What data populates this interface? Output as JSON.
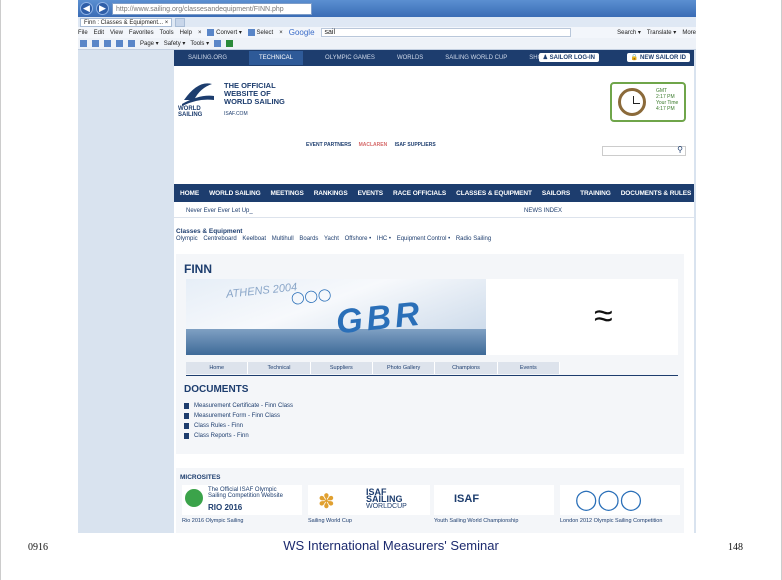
{
  "browser": {
    "back_icon": "back-arrow-icon",
    "forward_icon": "forward-arrow-icon",
    "url": "http://www.sailing.org/classesandequipment/FINN.php",
    "url_host": "sailing.org",
    "tab_title": "Finn : Classes & Equipment...",
    "menu": [
      "File",
      "Edit",
      "View",
      "Favorites",
      "Tools",
      "Help"
    ],
    "convert_label": "Convert",
    "select_label": "Select",
    "google_label": "Google",
    "google_query": "sail",
    "search_label": "Search",
    "translate_label": "Translate",
    "more_label": "More",
    "cmd_page": "Page",
    "cmd_safety": "Safety",
    "cmd_tools": "Tools"
  },
  "site": {
    "topnav": [
      "SAILING.ORG",
      "TECHNICAL",
      "OLYMPIC GAMES",
      "WORLDS",
      "SAILING WORLD CUP",
      "SHOP"
    ],
    "login_label": "SAILOR LOG-IN",
    "newid_label": "NEW SAILOR ID",
    "logo_lines": [
      "THE OFFICIAL",
      "WEBSITE OF",
      "WORLD SAILING"
    ],
    "logo_word1": "WORLD",
    "logo_word2": "SAILING",
    "isaf_com": "ISAF.COM",
    "clock": {
      "gmt": "GMT",
      "gmt_time": "2:17 PM",
      "your_time": "Your Time",
      "local_time": "4:17 PM"
    },
    "event_partners": "EVENT PARTNERS",
    "maclaren": "MACLAREN",
    "isaf_suppliers": "ISAF SUPPLIERS",
    "mainnav": [
      "HOME",
      "WORLD SAILING",
      "MEETINGS",
      "RANKINGS",
      "EVENTS",
      "RACE OFFICIALS",
      "CLASSES & EQUIPMENT",
      "SAILORS",
      "TRAINING",
      "DOCUMENTS & RULES"
    ],
    "ticker_left": "Never Ever Ever Let Up_",
    "ticker_right": "NEWS INDEX",
    "crumb_title": "Classes & Equipment",
    "crumb_links": [
      "Olympic",
      "Centreboard",
      "Keelboat",
      "Multihull",
      "Boards",
      "Yacht",
      "Offshore •",
      "IHC •",
      "Equipment Control •",
      "Radio Sailing"
    ],
    "finn_title": "FINN",
    "banner_text": "ATHENS 2004",
    "banner_gbr": "GBR",
    "subtabs": [
      "Home",
      "Technical",
      "Suppliers",
      "Photo Gallery",
      "Champions",
      "Events"
    ],
    "docs_title": "DOCUMENTS",
    "docs": [
      "Measurement Certificate - Finn Class",
      "Measurement Form - Finn Class",
      "Class Rules - Finn",
      "Class Reports - Finn"
    ],
    "microsites_title": "MICROSITES",
    "microsites": [
      {
        "caption": "Rio 2016 Olympic Sailing",
        "line1": "The Official ISAF Olympic",
        "line2": "Sailing Competition Website",
        "big": "RIO 2016"
      },
      {
        "caption": "Sailing World Cup",
        "line1": "ISAF",
        "line2": "SAILING",
        "line3": "WORLDCUP"
      },
      {
        "caption": "Youth Sailing World Championship",
        "big": "ISAF"
      },
      {
        "caption": "London 2012 Olympic Sailing Competition"
      }
    ]
  },
  "slide": {
    "left": "0916",
    "center": "WS International Measurers' Seminar",
    "right": "148"
  }
}
